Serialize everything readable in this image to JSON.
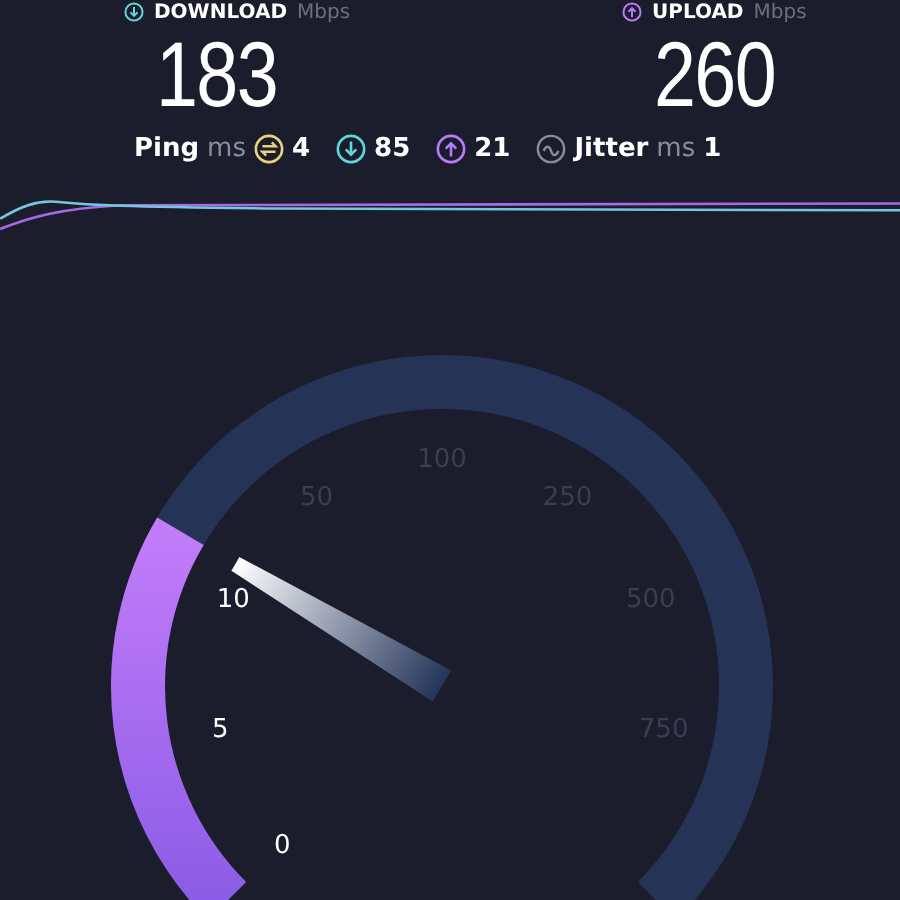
{
  "download": {
    "label": "DOWNLOAD",
    "unit": "Mbps",
    "value": "183"
  },
  "upload": {
    "label": "UPLOAD",
    "unit": "Mbps",
    "value": "260"
  },
  "ping": {
    "label": "Ping",
    "unit": "ms",
    "idle": "4",
    "download": "85",
    "upload": "21"
  },
  "jitter": {
    "label": "Jitter",
    "unit": "ms",
    "value": "1"
  },
  "gauge": {
    "ticks": [
      "0",
      "5",
      "10",
      "50",
      "100",
      "250",
      "500",
      "750"
    ]
  }
}
